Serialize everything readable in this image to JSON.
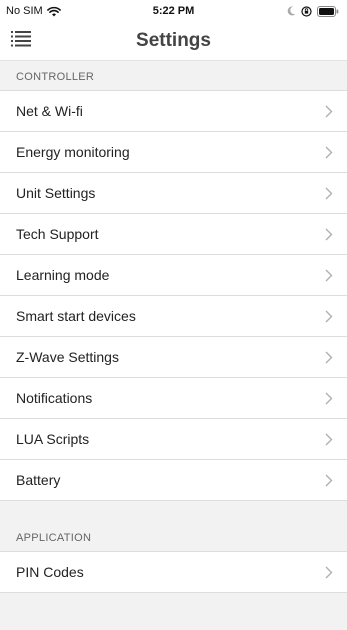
{
  "status_bar": {
    "carrier": "No SIM",
    "time": "5:22 PM"
  },
  "header": {
    "title": "Settings"
  },
  "sections": [
    {
      "title": "CONTROLLER",
      "items": [
        {
          "label": "Net & Wi-fi"
        },
        {
          "label": "Energy monitoring"
        },
        {
          "label": "Unit Settings"
        },
        {
          "label": "Tech Support"
        },
        {
          "label": "Learning mode"
        },
        {
          "label": "Smart start devices"
        },
        {
          "label": "Z-Wave Settings"
        },
        {
          "label": "Notifications"
        },
        {
          "label": "LUA Scripts"
        },
        {
          "label": "Battery"
        }
      ]
    },
    {
      "title": "APPLICATION",
      "items": [
        {
          "label": "PIN Codes"
        }
      ]
    }
  ],
  "icons": {
    "menu": "hamburger-menu-icon",
    "chevron": "chevron-right-icon",
    "wifi": "wifi-icon",
    "moon": "moon-icon",
    "lock": "orientation-lock-icon",
    "battery": "battery-icon"
  },
  "colors": {
    "background": "#f2f2f2",
    "list_background": "#ffffff",
    "divider": "#dddddd",
    "chevron": "#b0b0b0",
    "title": "#444444"
  }
}
